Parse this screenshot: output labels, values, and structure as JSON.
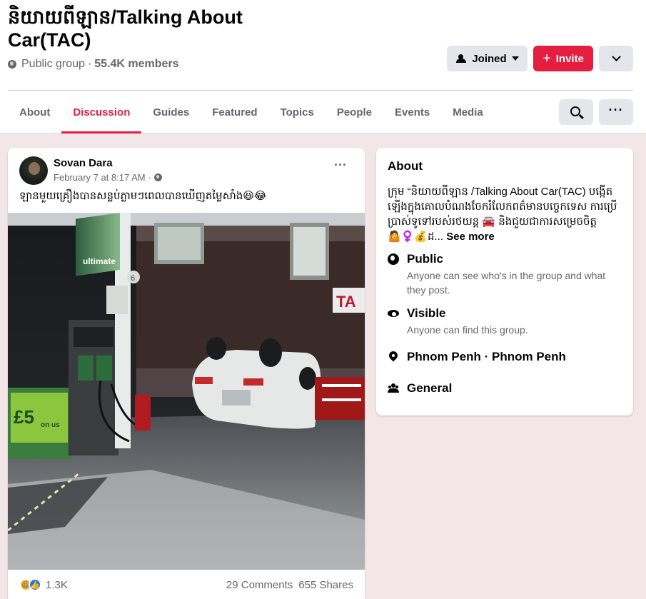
{
  "group": {
    "name": "និយាយពីឡាន/Talking About Car(TAC)",
    "privacy": "Public group",
    "separator": "·",
    "members": "55.4K members"
  },
  "actions": {
    "joined_label": "Joined",
    "invite_label": "Invite",
    "invite_icon": "+"
  },
  "tabs": [
    "About",
    "Discussion",
    "Guides",
    "Featured",
    "Topics",
    "People",
    "Events",
    "Media"
  ],
  "active_tab": "Discussion",
  "toolbar": {
    "more_glyph": "···"
  },
  "post": {
    "author": "Sovan Dara",
    "timestamp": "February 7 at 8:17 AM",
    "time_separator": "·",
    "options_glyph": "···",
    "text": "ឡានមួយគ្រឿងបានសន្លប់ភ្លាមៗពេលបានឃើញតម្លៃសាំង😆😂",
    "reaction_count": "1.3K",
    "comments": "29 Comments",
    "shares": "655 Shares",
    "photo": {
      "fuel_brand": "ultimate",
      "price_sign": "£5",
      "price_sign_sub": "on us",
      "pump_number": "6",
      "building_sign": "TA"
    }
  },
  "about": {
    "heading": "About",
    "description": "ក្រុម “និយាយពីឡាន /Talking About Car(TAC) បង្កើតឡើងក្នុងគោលបំណងចែករំលែកពត៌មានបច្ចេកទេស ការប្រើប្រាស់ទូទៅរបស់រថយន្ត 🚘 និងជួយជាការសម្រេចចិត្ត🤷‍♀️💰ដ...",
    "see_more": "See more",
    "items": [
      {
        "icon": "globe-icon",
        "title": "Public",
        "sub": "Anyone can see who's in the group and what they post."
      },
      {
        "icon": "eye-icon",
        "title": "Visible",
        "sub": "Anyone can find this group."
      },
      {
        "icon": "location-pin-icon",
        "title": "Phnom Penh · Phnom Penh",
        "sub": ""
      },
      {
        "icon": "people-icon",
        "title": "General",
        "sub": ""
      }
    ]
  },
  "colors": {
    "accent": "#e41e3f",
    "page_background": "#f2e6e8",
    "button_gray": "#e4e6eb",
    "secondary_text": "#65676b"
  }
}
